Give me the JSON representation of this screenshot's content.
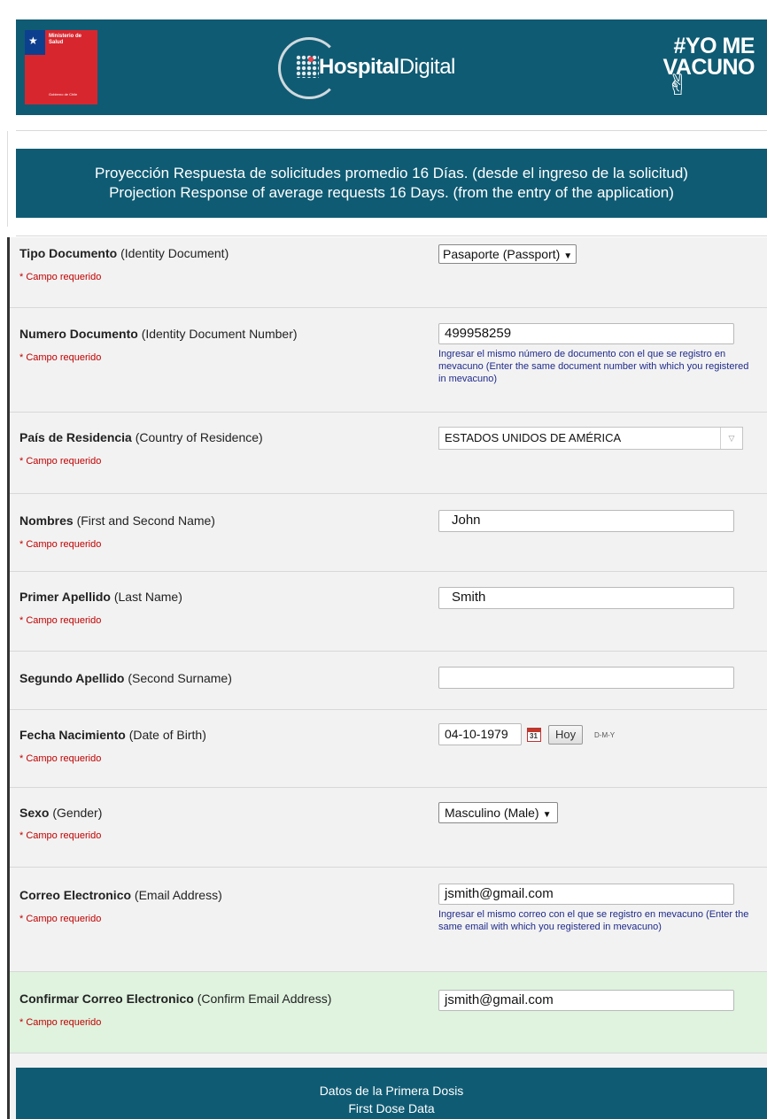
{
  "header": {
    "ministerio_label": "Ministerio de Salud",
    "gobierno_label": "Gobierno de Chile",
    "logo_text_bold": "Hospital",
    "logo_text_light": "Digital",
    "campaign_line1": "#YO ME",
    "campaign_line2": "VACUNO"
  },
  "banner": {
    "line1": "Proyección Respuesta de solicitudes promedio 16 Días. (desde el ingreso de la solicitud)",
    "line2": "Projection Response of average requests 16 Days. (from the entry of the application)"
  },
  "required_text": "* Campo requerido",
  "fields": {
    "tipo_documento": {
      "label": "Tipo Documento",
      "sublabel": "(Identity Document)",
      "value": "Pasaporte (Passport)"
    },
    "numero_documento": {
      "label": "Numero Documento",
      "sublabel": "(Identity Document Number)",
      "value": "499958259",
      "hint": "Ingresar el mismo número de documento con el que se registro en mevacuno (Enter the same document number with which you registered in mevacuno)"
    },
    "pais_residencia": {
      "label": "País de Residencia",
      "sublabel": "(Country of Residence)",
      "value": "ESTADOS UNIDOS DE AMÉRICA"
    },
    "nombres": {
      "label": "Nombres",
      "sublabel": "(First and Second Name)",
      "value": "John"
    },
    "primer_apellido": {
      "label": "Primer Apellido",
      "sublabel": "(Last Name)",
      "value": "Smith"
    },
    "segundo_apellido": {
      "label": "Segundo Apellido",
      "sublabel": "(Second Surname)",
      "value": ""
    },
    "fecha_nacimiento": {
      "label": "Fecha Nacimiento",
      "sublabel": "(Date of Birth)",
      "value": "04-10-1979",
      "calendar_day": "31",
      "today_button": "Hoy",
      "format": "D-M-Y"
    },
    "sexo": {
      "label": "Sexo",
      "sublabel": "(Gender)",
      "value": "Masculino (Male)"
    },
    "correo": {
      "label": "Correo Electronico",
      "sublabel": "(Email Address)",
      "value": "jsmith@gmail.com",
      "hint": "Ingresar el mismo correo con el que se registro en mevacuno (Enter the same email with which you registered in mevacuno)"
    },
    "confirmar_correo": {
      "label": "Confirmar Correo Electronico",
      "sublabel": "(Confirm Email Address)",
      "value": "jsmith@gmail.com"
    }
  },
  "section": {
    "line1": "Datos de la Primera Dosis",
    "line2": "First Dose Data"
  },
  "colors": {
    "primary": "#0f5b73",
    "required": "#c00000",
    "hint": "#1f2a8a",
    "highlight_row": "#dff3df"
  }
}
